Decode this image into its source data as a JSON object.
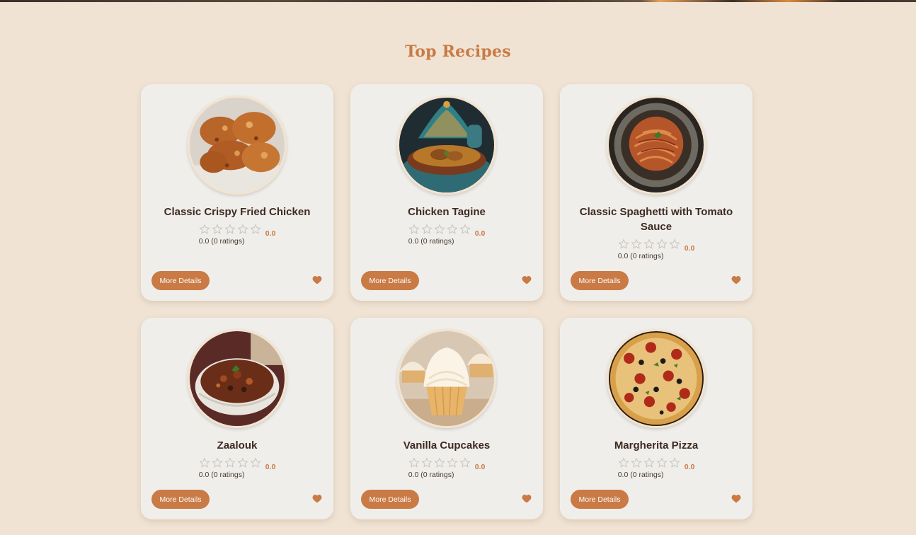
{
  "section": {
    "title": "Top Recipes"
  },
  "colors": {
    "accent": "#c97a45",
    "background": "#f0e3d3",
    "card": "#f0eeea"
  },
  "recipes": [
    {
      "title": "Classic Crispy Fried Chicken",
      "rating_text": "0.0 (0 ratings)",
      "rating_value": "0.0",
      "button_label": "More Details",
      "image": "fried-chicken-image",
      "stars": 0
    },
    {
      "title": "Chicken Tagine",
      "rating_text": "0.0 (0 ratings)",
      "rating_value": "0.0",
      "button_label": "More Details",
      "image": "chicken-tagine-image",
      "stars": 0
    },
    {
      "title": "Classic Spaghetti with Tomato Sauce",
      "rating_text": "0.0 (0 ratings)",
      "rating_value": "0.0",
      "button_label": "More Details",
      "image": "spaghetti-image",
      "stars": 0
    },
    {
      "title": "Zaalouk",
      "rating_text": "0.0 (0 ratings)",
      "rating_value": "0.0",
      "button_label": "More Details",
      "image": "zaalouk-image",
      "stars": 0
    },
    {
      "title": "Vanilla Cupcakes",
      "rating_text": "0.0 (0 ratings)",
      "rating_value": "0.0",
      "button_label": "More Details",
      "image": "cupcakes-image",
      "stars": 0
    },
    {
      "title": "Margherita Pizza",
      "rating_text": "0.0 (0 ratings)",
      "rating_value": "0.0",
      "button_label": "More Details",
      "image": "pizza-image",
      "stars": 0
    }
  ]
}
